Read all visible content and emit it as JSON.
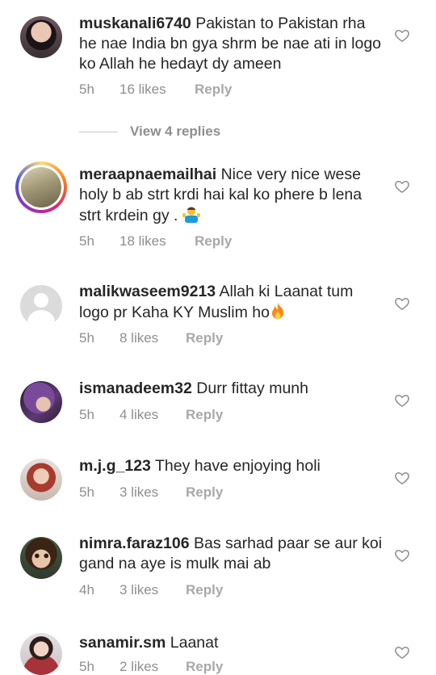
{
  "comments": [
    {
      "username": "muskanali6740",
      "text": "Pakistan to Pakistan rha he nae India bn gya shrm be nae ati in logo ko Allah he hedayt dy ameen",
      "time": "5h",
      "likes": "16 likes",
      "reply": "Reply",
      "avatar": "photo",
      "avatar_color": "#3a2f33"
    },
    {
      "username": "meraapnaemailhai",
      "text": "Nice very nice wese holy b ab strt krdi hai kal ko phere b lena strt krdein gy .",
      "emoji": "person-shrugging-emoji",
      "time": "5h",
      "likes": "18 likes",
      "reply": "Reply",
      "avatar": "photo-with-story-ring",
      "avatar_color": "#a39a78"
    },
    {
      "username": "malikwaseem9213",
      "text": "Allah ki Laanat tum logo pr Kaha KY Muslim ho",
      "emoji": "fire-emoji",
      "time": "5h",
      "likes": "8 likes",
      "reply": "Reply",
      "avatar": "default-silhouette",
      "avatar_color": "#dbdbdb"
    },
    {
      "username": "ismanadeem32",
      "text": "Durr fittay munh",
      "time": "5h",
      "likes": "4 likes",
      "reply": "Reply",
      "avatar": "photo",
      "avatar_color": "#4b2a5c"
    },
    {
      "username": "m.j.g_123",
      "text": "They have enjoying holi",
      "time": "5h",
      "likes": "3 likes",
      "reply": "Reply",
      "avatar": "photo",
      "avatar_color": "#b8483a"
    },
    {
      "username": "nimra.faraz106",
      "text": "Bas sarhad paar se aur koi gand na aye is mulk mai ab",
      "time": "4h",
      "likes": "3 likes",
      "reply": "Reply",
      "avatar": "photo",
      "avatar_color": "#2e3a2c"
    },
    {
      "username": "sanamir.sm",
      "text": "Laanat",
      "time": "5h",
      "likes": "2 likes",
      "reply": "Reply",
      "avatar": "photo",
      "avatar_color": "#c9c2c4"
    }
  ],
  "view_replies": "View 4 replies",
  "icons": {
    "like": "heart-outline-icon"
  },
  "colors": {
    "text": "#262626",
    "secondary": "#8e8e8e",
    "background": "#ffffff"
  }
}
